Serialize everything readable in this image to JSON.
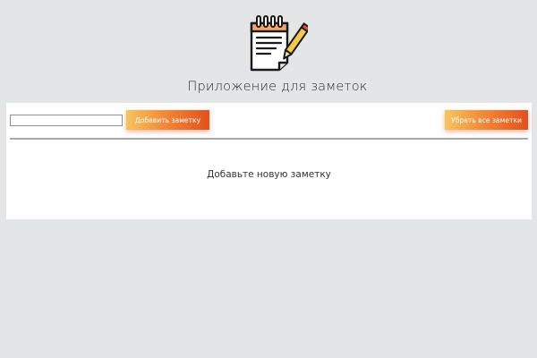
{
  "header": {
    "logo_icon": "notepad-with-pencil-icon",
    "title": "Приложение для заметок"
  },
  "toolbar": {
    "note_input_value": "",
    "add_label": "Добавить заметку",
    "clear_all_label": "Убрать все заметки"
  },
  "notes": {
    "empty_message": "Добавьте новую заметку",
    "items": []
  },
  "colors": {
    "page_background": "#e4e5e7",
    "panel_background": "#ffffff",
    "button_gradient_start": "#f6c55d",
    "button_gradient_end": "#e4501c",
    "divider": "#a8a8a8"
  }
}
